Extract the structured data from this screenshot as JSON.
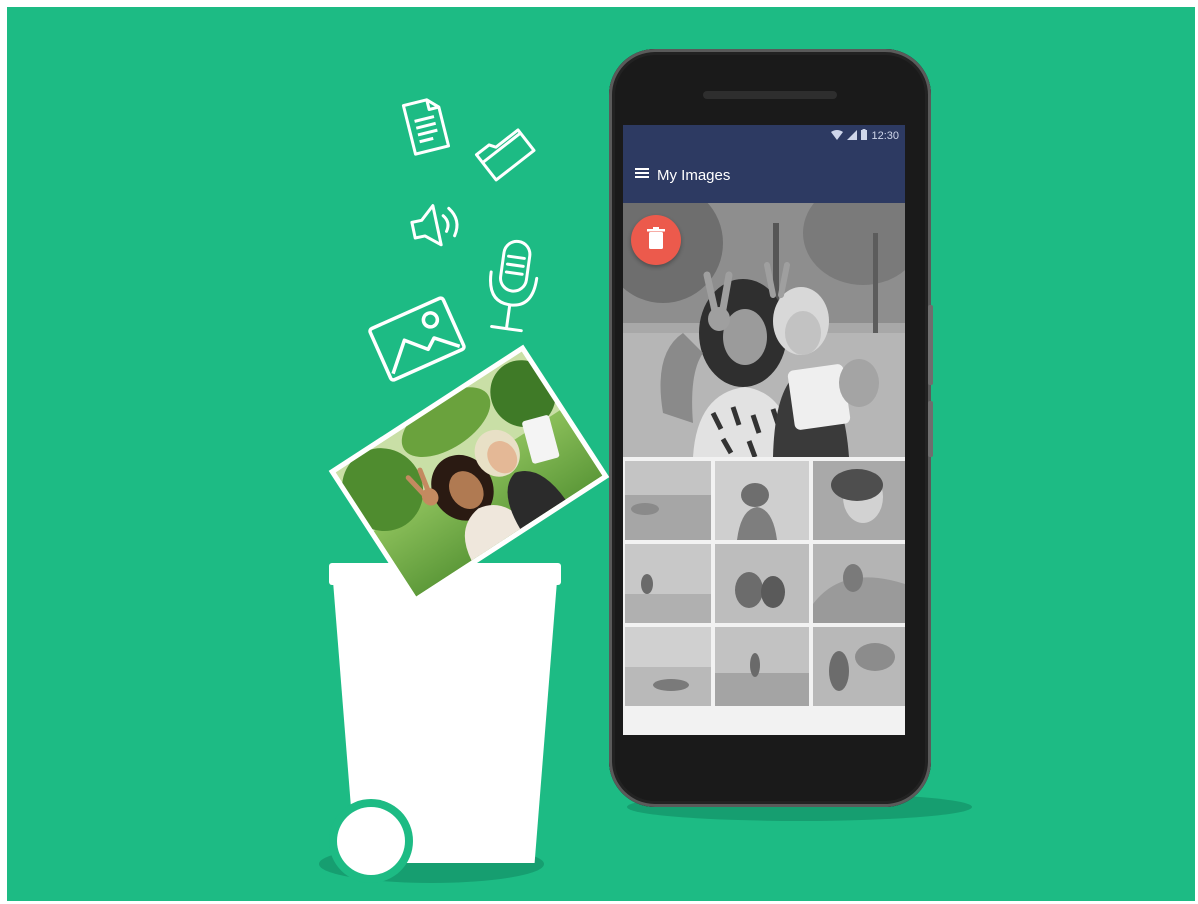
{
  "app": {
    "title": "My Images",
    "status_time": "12:30"
  },
  "icons": [
    "document-icon",
    "folder-icon",
    "speaker-icon",
    "microphone-icon",
    "image-icon",
    "menu-icon",
    "trash-icon",
    "wifi-icon",
    "signal-icon",
    "battery-icon"
  ],
  "colors": {
    "background": "#1dbb84",
    "app_bar": "#2d3a62",
    "delete_button": "#ec5a4c",
    "bin": "#ffffff"
  },
  "gallery": {
    "grid_count": 9
  }
}
